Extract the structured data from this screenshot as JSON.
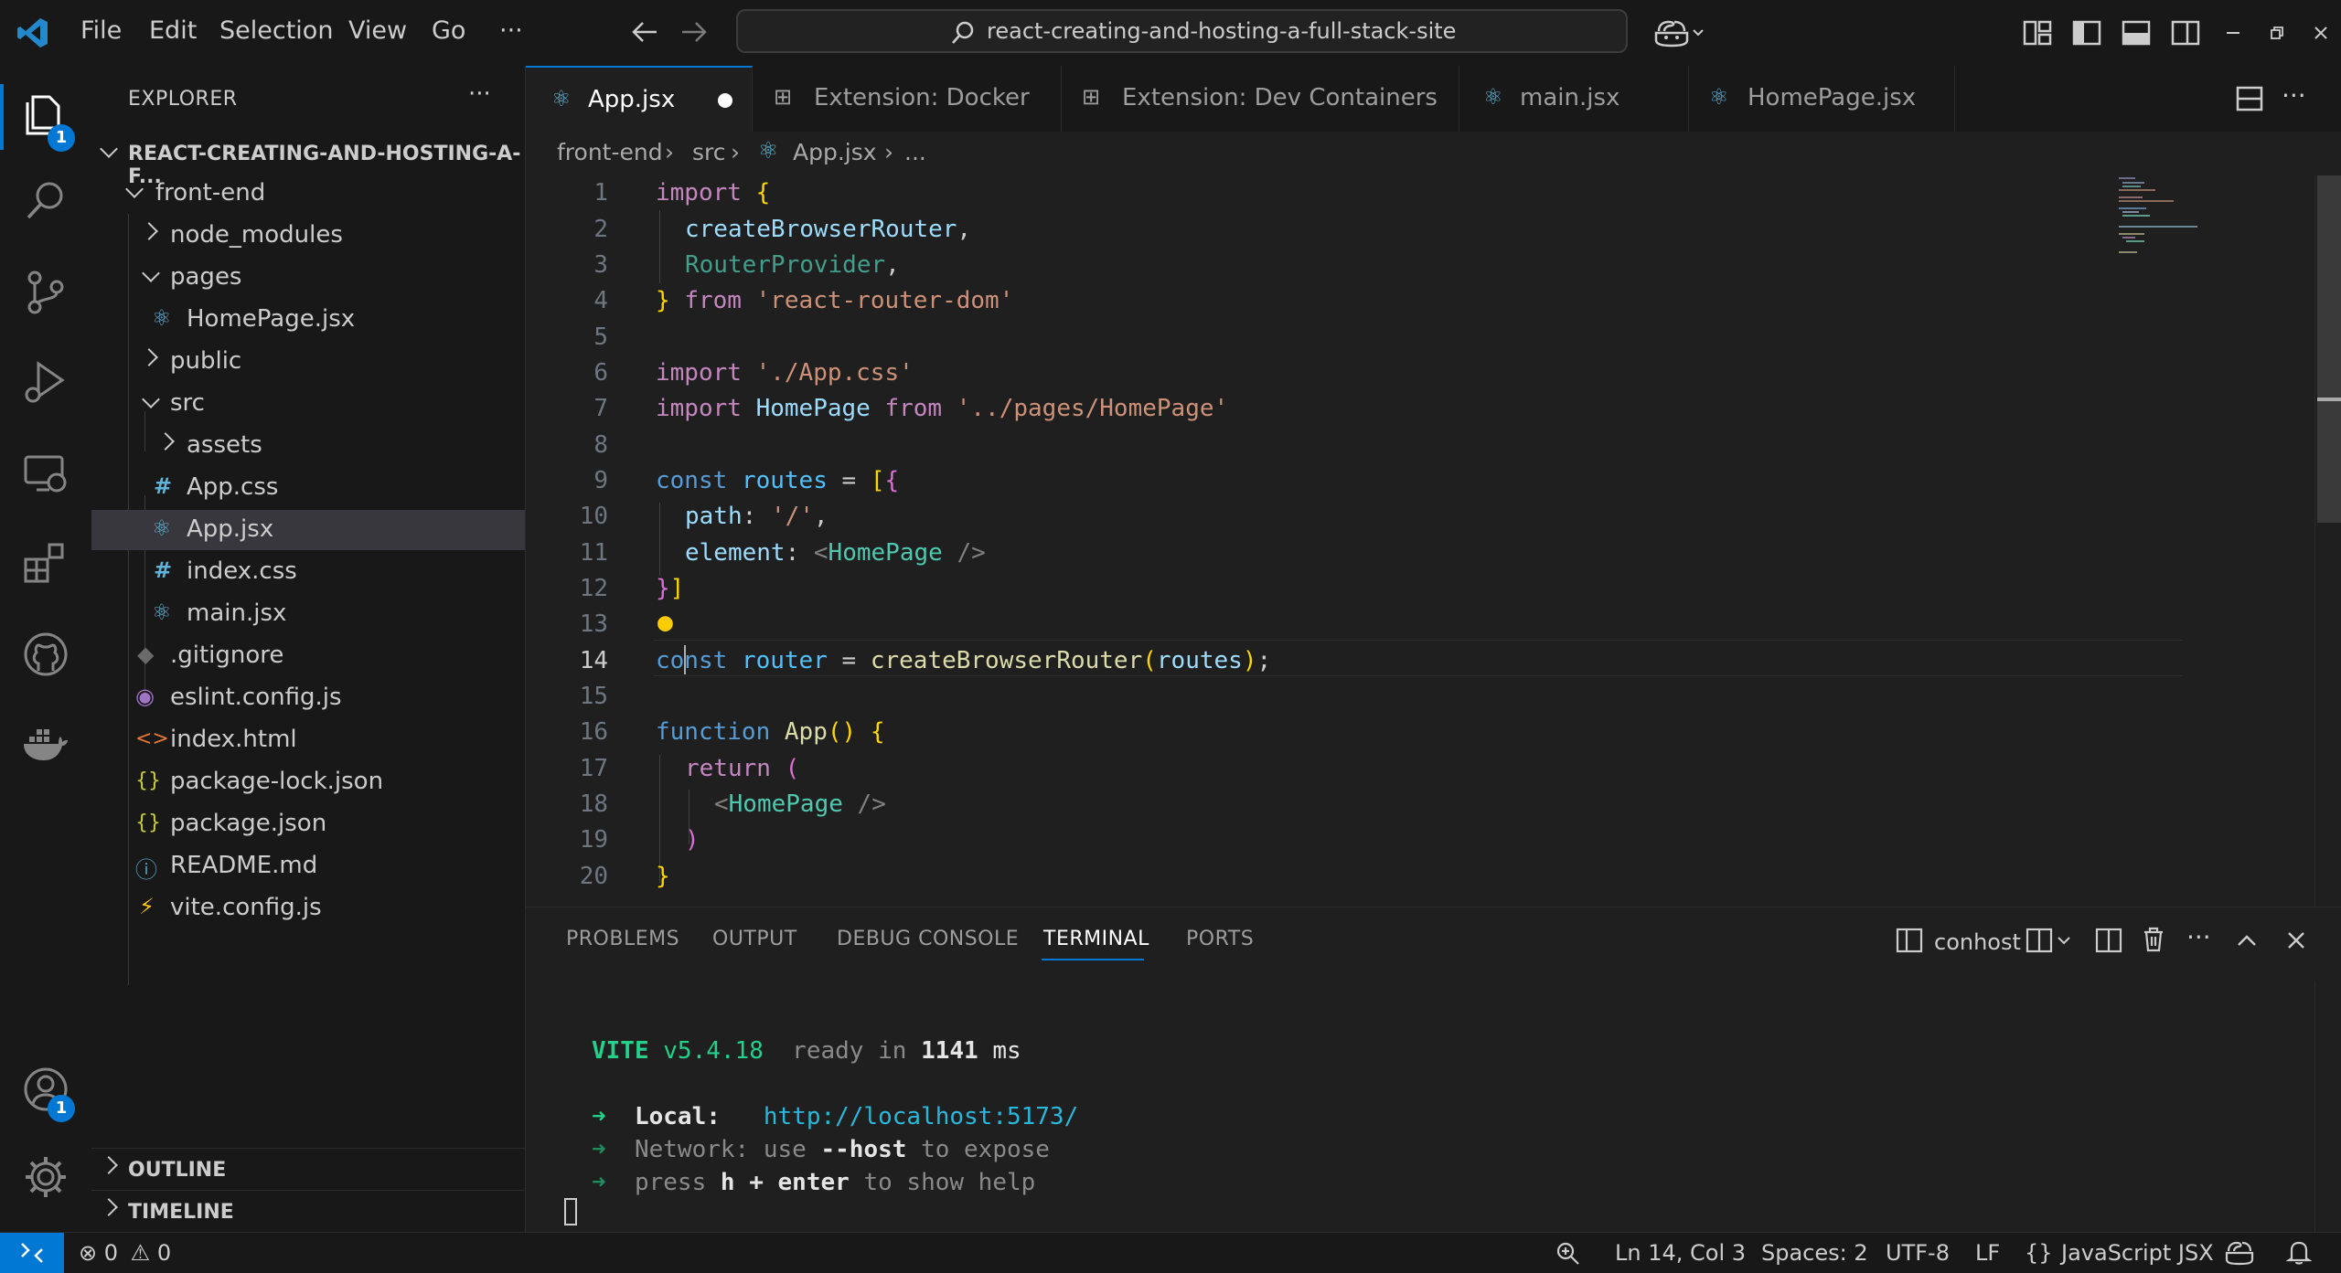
{
  "menu": {
    "file": "File",
    "edit": "Edit",
    "selection": "Selection",
    "view": "View",
    "go": "Go",
    "more": "···"
  },
  "title_search": {
    "text": "react-creating-and-hosting-a-full-stack-site"
  },
  "activity": {
    "explorer_badge": "1",
    "accounts_badge": "1"
  },
  "explorer": {
    "header": "EXPLORER",
    "more": "···",
    "root": "REACT-CREATING-AND-HOSTING-A-F...",
    "items": [
      {
        "label": "front-end",
        "kind": "folder-open"
      },
      {
        "label": "node_modules",
        "kind": "folder"
      },
      {
        "label": "pages",
        "kind": "folder-open"
      },
      {
        "label": "HomePage.jsx",
        "kind": "react"
      },
      {
        "label": "public",
        "kind": "folder"
      },
      {
        "label": "src",
        "kind": "folder-open"
      },
      {
        "label": "assets",
        "kind": "folder"
      },
      {
        "label": "App.css",
        "kind": "css"
      },
      {
        "label": "App.jsx",
        "kind": "react"
      },
      {
        "label": "index.css",
        "kind": "css"
      },
      {
        "label": "main.jsx",
        "kind": "react"
      },
      {
        "label": ".gitignore",
        "kind": "git"
      },
      {
        "label": "eslint.config.js",
        "kind": "eslint"
      },
      {
        "label": "index.html",
        "kind": "html"
      },
      {
        "label": "package-lock.json",
        "kind": "json"
      },
      {
        "label": "package.json",
        "kind": "json"
      },
      {
        "label": "README.md",
        "kind": "info"
      },
      {
        "label": "vite.config.js",
        "kind": "vite"
      }
    ],
    "outline": "OUTLINE",
    "timeline": "TIMELINE"
  },
  "tabs": [
    {
      "label": "App.jsx",
      "icon": "react-icon",
      "active": true,
      "dirty": true
    },
    {
      "label": "Extension: Docker",
      "icon": "extensions-icon"
    },
    {
      "label": "Extension: Dev Containers",
      "icon": "extensions-icon"
    },
    {
      "label": "main.jsx",
      "icon": "react-icon"
    },
    {
      "label": "HomePage.jsx",
      "icon": "react-icon"
    }
  ],
  "breadcrumb": {
    "p1": "front-end",
    "p2": "src",
    "p3": "App.jsx",
    "p4": "..."
  },
  "editor": {
    "line_numbers": [
      "1",
      "2",
      "3",
      "4",
      "5",
      "6",
      "7",
      "8",
      "9",
      "10",
      "11",
      "12",
      "13",
      "14",
      "15",
      "16",
      "17",
      "18",
      "19",
      "20"
    ],
    "current_line": "14",
    "code": {
      "l1a": "import",
      "l1b": "{",
      "l2": "createBrowserRouter",
      "l3": "RouterProvider",
      "l4a": "}",
      "l4b": "from",
      "l4c": "'react-router-dom'",
      "l6a": "import",
      "l6b": "'./App.css'",
      "l7a": "import",
      "l7b": "HomePage",
      "l7c": "from",
      "l7d": "'../pages/HomePage'",
      "l9a": "const",
      "l9b": "routes",
      "l9c": "=",
      "l9d": "[",
      "l9e": "{",
      "l10a": "path",
      "l10b": "'/'",
      "l11a": "element",
      "l11b": "HomePage",
      "l12a": "}",
      "l12b": "]",
      "l14a": "const",
      "l14b": "router",
      "l14c": "=",
      "l14d": "createBrowserRouter",
      "l14e": "routes",
      "l16a": "function",
      "l16b": "App",
      "l16c": "{",
      "l17a": "return",
      "l17b": "(",
      "l18": "HomePage",
      "l19": ")",
      "l20": "}"
    }
  },
  "panel": {
    "tabs": {
      "problems": "PROBLEMS",
      "output": "OUTPUT",
      "debug": "DEBUG CONSOLE",
      "terminal": "TERMINAL",
      "ports": "PORTS"
    },
    "terminal_name": "conhost",
    "terminal": {
      "vite": "VITE",
      "version": "v5.4.18",
      "ready": "ready in",
      "ms_value": "1141",
      "ms": "ms",
      "local_label": "Local:",
      "local_url": "http://localhost:5173/",
      "network_label": "Network:",
      "network_use": "use",
      "network_flag": "--host",
      "network_rest": "to expose",
      "press": "press",
      "press_key": "h + enter",
      "press_rest": "to show help"
    }
  },
  "status": {
    "errors": "0",
    "warnings": "0",
    "position": "Ln 14, Col 3",
    "spaces": "Spaces: 2",
    "encoding": "UTF-8",
    "eol": "LF",
    "language_braces": "{}",
    "language": "JavaScript JSX"
  },
  "colors": {
    "accent": "#0078d4",
    "bg": "#1f1f1f",
    "sidebar": "#181818"
  }
}
